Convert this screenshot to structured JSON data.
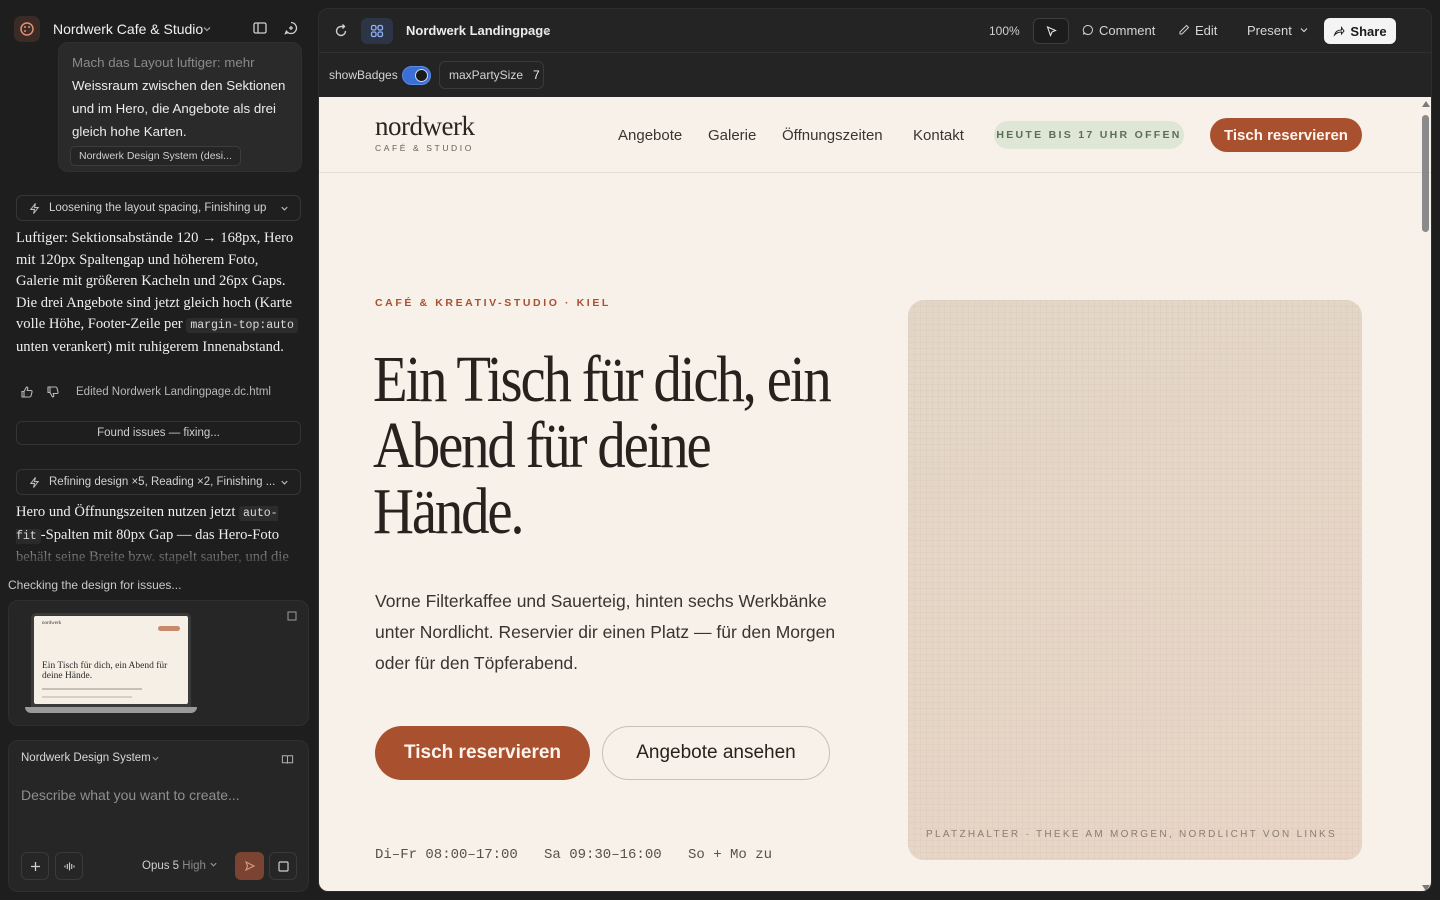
{
  "project": {
    "name": "Nordwerk Cafe & Studio"
  },
  "chat": {
    "prev_message": {
      "faded_line": "Mach das Layout luftiger: mehr",
      "text": "Weissraum zwischen den Sektionen und im Hero, die Angebote als drei gleich hohe Karten.",
      "chip": "Nordwerk Design System (desi..."
    },
    "step1": {
      "label": "Loosening the layout spacing, Finishing up"
    },
    "reply1": {
      "before_code": "Luftiger: Sektionsabstände 120 → 168px, Hero mit 120px Spaltengap und höherem Foto, Galerie mit größeren Kacheln und 26px Gaps. Die drei Angebote sind jetzt gleich hoch (Karte volle Höhe, Footer-Zeile per ",
      "code": "margin-top:auto",
      "after_code": " unten verankert) mit ruhigerem Innenabstand."
    },
    "edited_label": "Edited Nordwerk Landingpage.dc.html",
    "status": "Found issues — fixing...",
    "step2": {
      "label": "Refining design ×5, Reading ×2, Finishing ..."
    },
    "reply2": {
      "before_code": "Hero und Öffnungszeiten nutzen jetzt ",
      "code": "auto-fit",
      "after_code": "-Spalten mit 80px Gap — das Hero-Foto behält seine Breite bzw. stapelt sauber, und die"
    },
    "checking": "Checking the design for issues...",
    "thumbnail": {
      "logo": "nordwerk",
      "headline": "Ein Tisch für dich, ein Abend für deine Hände."
    }
  },
  "composer": {
    "design_system": "Nordwerk Design System",
    "placeholder": "Describe what you want to create...",
    "model": "Opus 5",
    "effort": "High"
  },
  "toolbar": {
    "title": "Nordwerk Landingpage",
    "zoom": "100%",
    "comment": "Comment",
    "edit": "Edit",
    "present": "Present",
    "share": "Share"
  },
  "props": {
    "show_badges_label": "showBadges",
    "show_badges": true,
    "max_party_label": "maxPartySize",
    "max_party_value": "7"
  },
  "site": {
    "logo": "nordwerk",
    "logo_sub": "CAFÉ & STUDIO",
    "nav": [
      "Angebote",
      "Galerie",
      "Öffnungszeiten",
      "Kontakt"
    ],
    "badge": "HEUTE BIS 17 UHR OFFEN",
    "cta_top": "Tisch reservieren",
    "kicker": "CAFÉ & KREATIV-STUDIO · KIEL",
    "headline": "Ein Tisch für dich, ein Abend für deine Hände.",
    "lead": "Vorne Filterkaffee und Sauerteig, hinten sechs Werkbänke unter Nordlicht. Reservier dir einen Platz — für den Morgen oder für den Töpferabend.",
    "btn_primary": "Tisch reservieren",
    "btn_secondary": "Angebote ansehen",
    "hours": [
      "Di–Fr 08:00–17:00",
      "Sa 09:30–16:00",
      "So + Mo zu"
    ],
    "photo_caption": "PLATZHALTER · THEKE AM MORGEN, NORDLICHT VON LINKS"
  },
  "colors": {
    "accent": "#a9502f",
    "site_bg": "#f7f1e9",
    "badge_bg": "#dfe6d5",
    "toggle_on": "#3b6fd6"
  }
}
